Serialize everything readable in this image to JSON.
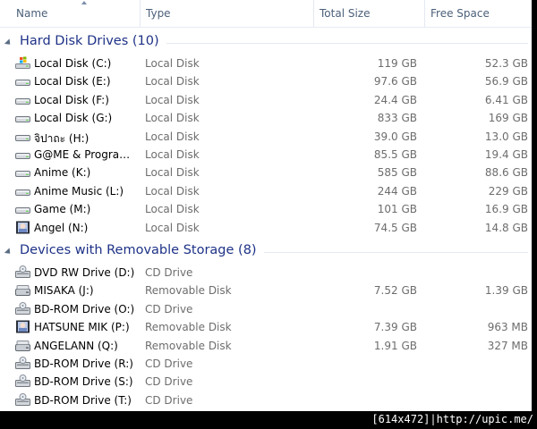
{
  "columns": {
    "name": "Name",
    "type": "Type",
    "total_size": "Total Size",
    "free_space": "Free Space"
  },
  "groups": [
    {
      "title": "Hard Disk Drives (10)",
      "items": [
        {
          "icon": "windows-drive-icon",
          "name": "Local Disk (C:)",
          "type": "Local Disk",
          "total": "119 GB",
          "free": "52.3 GB"
        },
        {
          "icon": "hard-drive-icon",
          "name": "Local Disk (E:)",
          "type": "Local Disk",
          "total": "97.6 GB",
          "free": "56.9 GB"
        },
        {
          "icon": "hard-drive-icon",
          "name": "Local Disk (F:)",
          "type": "Local Disk",
          "total": "24.4 GB",
          "free": "6.41 GB"
        },
        {
          "icon": "hard-drive-icon",
          "name": "Local Disk (G:)",
          "type": "Local Disk",
          "total": "833 GB",
          "free": "169 GB"
        },
        {
          "icon": "hard-drive-icon",
          "name": "จิปาถะ (H:)",
          "type": "Local Disk",
          "total": "39.0 GB",
          "free": "13.0 GB"
        },
        {
          "icon": "hard-drive-icon",
          "name": "G@ME & Progra…",
          "type": "Local Disk",
          "total": "85.5 GB",
          "free": "19.4 GB"
        },
        {
          "icon": "hard-drive-icon",
          "name": "Anime (K:)",
          "type": "Local Disk",
          "total": "585 GB",
          "free": "88.6 GB"
        },
        {
          "icon": "hard-drive-icon",
          "name": "Anime Music (L:)",
          "type": "Local Disk",
          "total": "244 GB",
          "free": "229 GB"
        },
        {
          "icon": "hard-drive-icon",
          "name": "Game (M:)",
          "type": "Local Disk",
          "total": "101 GB",
          "free": "16.9 GB"
        },
        {
          "icon": "custom-drive-icon",
          "name": "Angel (N:)",
          "type": "Local Disk",
          "total": "74.5 GB",
          "free": "14.8 GB"
        }
      ]
    },
    {
      "title": "Devices with Removable Storage (8)",
      "items": [
        {
          "icon": "optical-drive-icon",
          "name": "DVD RW Drive (D:)",
          "type": "CD Drive",
          "total": "",
          "free": ""
        },
        {
          "icon": "removable-drive-icon",
          "name": "MISAKA (J:)",
          "type": "Removable Disk",
          "total": "7.52 GB",
          "free": "1.39 GB"
        },
        {
          "icon": "optical-drive-icon",
          "name": "BD-ROM Drive (O:)",
          "type": "CD Drive",
          "total": "",
          "free": ""
        },
        {
          "icon": "custom-drive-icon",
          "name": "HATSUNE MIK (P:)",
          "type": "Removable Disk",
          "total": "7.39 GB",
          "free": "963 MB"
        },
        {
          "icon": "removable-drive-icon",
          "name": "ANGELANN (Q:)",
          "type": "Removable Disk",
          "total": "1.91 GB",
          "free": "327 MB"
        },
        {
          "icon": "optical-drive-icon",
          "name": "BD-ROM Drive (R:)",
          "type": "CD Drive",
          "total": "",
          "free": ""
        },
        {
          "icon": "optical-drive-icon",
          "name": "BD-ROM Drive (S:)",
          "type": "CD Drive",
          "total": "",
          "free": ""
        },
        {
          "icon": "optical-drive-icon",
          "name": "BD-ROM Drive (T:)",
          "type": "CD Drive",
          "total": "",
          "free": ""
        }
      ]
    }
  ],
  "watermark": "[614x472]|http://upic.me/"
}
